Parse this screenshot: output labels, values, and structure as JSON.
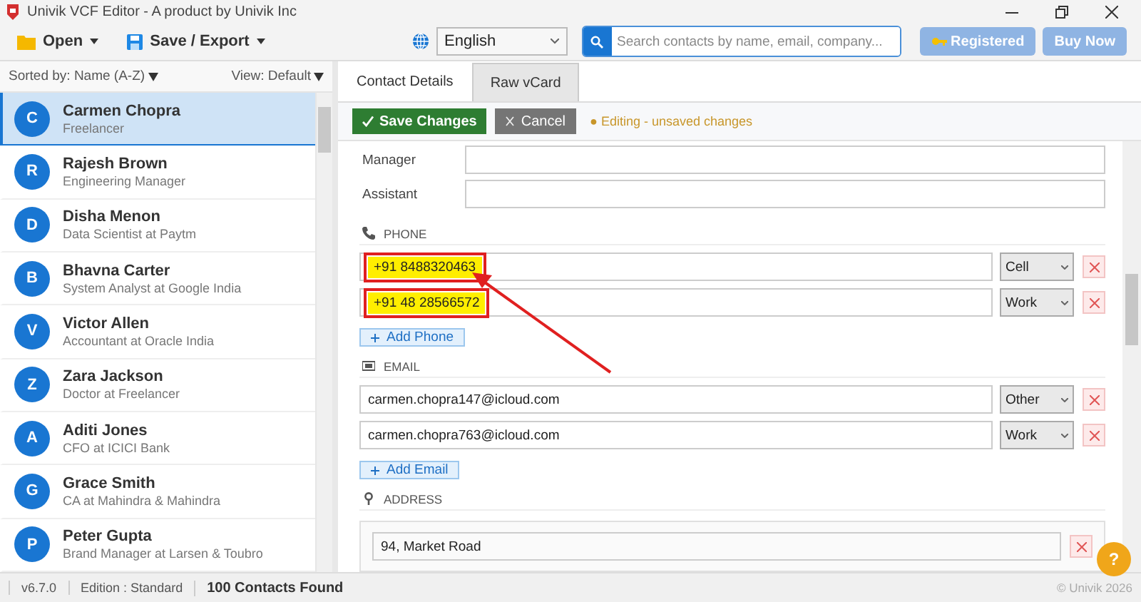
{
  "window": {
    "title": "Univik VCF Editor - A product by Univik Inc"
  },
  "toolbar": {
    "open": "Open",
    "save_export": "Save / Export",
    "language": "English",
    "search": {
      "placeholder": "Search contacts by name, email, company..."
    },
    "registered": "Registered",
    "buy_now": "Buy Now"
  },
  "sidebar": {
    "sort": "Sorted by: Name (A-Z)",
    "view": "View: Default",
    "contacts": [
      {
        "initial": "C",
        "name": "Carmen Chopra",
        "subtitle": "Freelancer",
        "selected": true
      },
      {
        "initial": "R",
        "name": "Rajesh Brown",
        "subtitle": "Engineering Manager",
        "selected": false
      },
      {
        "initial": "D",
        "name": "Disha Menon",
        "subtitle": "Data Scientist at Paytm",
        "selected": false
      },
      {
        "initial": "B",
        "name": "Bhavna Carter",
        "subtitle": "System Analyst at Google India",
        "selected": false
      },
      {
        "initial": "V",
        "name": "Victor Allen",
        "subtitle": "Accountant at Oracle India",
        "selected": false
      },
      {
        "initial": "Z",
        "name": "Zara Jackson",
        "subtitle": "Doctor at Freelancer",
        "selected": false
      },
      {
        "initial": "A",
        "name": "Aditi Jones",
        "subtitle": "CFO at ICICI Bank",
        "selected": false
      },
      {
        "initial": "G",
        "name": "Grace Smith",
        "subtitle": "CA at Mahindra & Mahindra",
        "selected": false
      },
      {
        "initial": "P",
        "name": "Peter Gupta",
        "subtitle": "Brand Manager at Larsen & Toubro",
        "selected": false
      }
    ]
  },
  "editor": {
    "tabs": [
      {
        "label": "Contact Details",
        "selected": true
      },
      {
        "label": "Raw vCard",
        "selected": false
      }
    ],
    "save": "Save Changes",
    "cancel": "Cancel",
    "status": "● Editing - unsaved changes",
    "fields": [
      {
        "label": "Manager"
      },
      {
        "label": "Assistant"
      }
    ],
    "phone": {
      "heading": "PHONE",
      "items": [
        {
          "value": "+91 8488320463",
          "type": "Cell",
          "highlighted": true
        },
        {
          "value": "+91 48 28566572",
          "type": "Work",
          "highlighted": true
        }
      ],
      "add": "Add Phone"
    },
    "email": {
      "heading": "EMAIL",
      "items": [
        {
          "value": "carmen.chopra147@icloud.com",
          "type": "Other"
        },
        {
          "value": "carmen.chopra763@icloud.com",
          "type": "Work"
        }
      ],
      "add": "Add Email"
    },
    "address": {
      "heading": "ADDRESS",
      "street": "94, Market Road"
    },
    "help": "?"
  },
  "status_bar": {
    "version": "v6.7.0",
    "edition": "Edition : Standard",
    "count": "100 Contacts Found",
    "copyright": "© Univik 2026"
  }
}
